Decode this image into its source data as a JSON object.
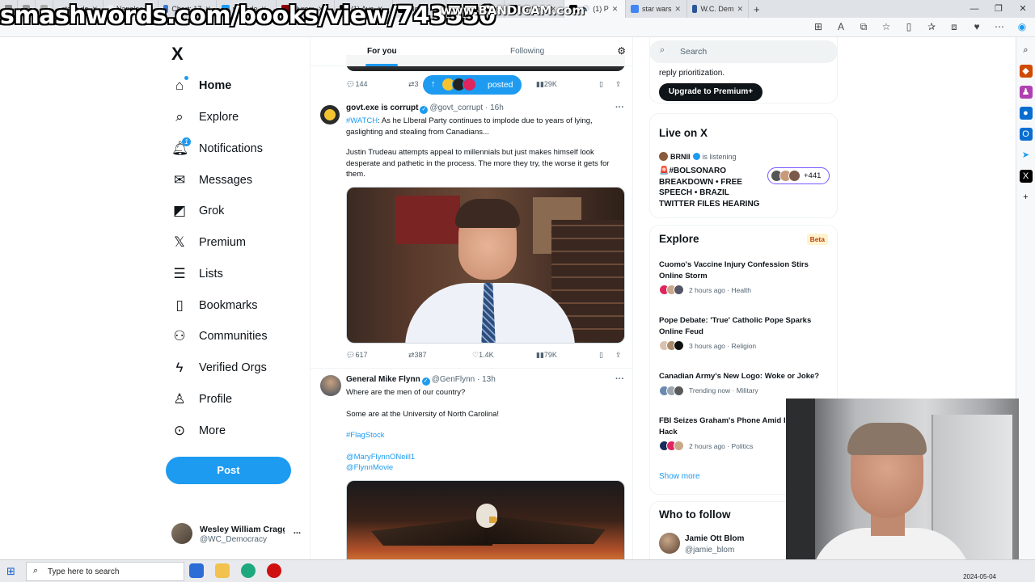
{
  "watermark": "smashwords.com/books/view/743550",
  "recorder": "www.BANDICAM.com",
  "browser": {
    "tabs": [
      {
        "label": "stalin de"
      },
      {
        "label": "Napoleo"
      },
      {
        "label": "Chart: 17"
      },
      {
        "label": "ww2 de"
      },
      {
        "label": "Nurem"
      },
      {
        "label": "(1) Ava"
      },
      {
        "label": "Home"
      },
      {
        "label": "waking u"
      },
      {
        "label": "(1) Dom"
      },
      {
        "label": "(1) P"
      },
      {
        "label": "star wars"
      },
      {
        "label": "W.C. Dem"
      }
    ],
    "new_tab": "+"
  },
  "nav": {
    "logo": "X",
    "items": [
      {
        "label": "Home",
        "icon": "home-icon"
      },
      {
        "label": "Explore",
        "icon": "search-icon"
      },
      {
        "label": "Notifications",
        "icon": "bell-icon",
        "badge": "1"
      },
      {
        "label": "Messages",
        "icon": "envelope-icon"
      },
      {
        "label": "Grok",
        "icon": "grok-icon"
      },
      {
        "label": "Premium",
        "icon": "x-icon"
      },
      {
        "label": "Lists",
        "icon": "list-icon"
      },
      {
        "label": "Bookmarks",
        "icon": "bookmark-icon"
      },
      {
        "label": "Communities",
        "icon": "people-icon"
      },
      {
        "label": "Verified Orgs",
        "icon": "lightning-icon"
      },
      {
        "label": "Profile",
        "icon": "person-icon"
      },
      {
        "label": "More",
        "icon": "more-circle-icon"
      }
    ],
    "post_button": "Post",
    "account": {
      "name": "Wesley William Cragg",
      "handle": "@WC_Democracy",
      "more": "..."
    }
  },
  "timeline": {
    "tabs": [
      "For you",
      "Following"
    ],
    "posted_pill": "posted",
    "prev_actions": {
      "replies": "144",
      "reposts": "3",
      "likes": "",
      "views": "29K"
    },
    "tweets": [
      {
        "name": "govt.exe is corrupt",
        "handle": "@govt_corrupt",
        "time": "· 16h",
        "hashtag": "#WATCH",
        "text1": ": As he LIberal Party continues to  implode due to years of lying, gaslighting and stealing from Canadians...",
        "text2": "Justin Trudeau attempts appeal to millennials but just makes himself look desperate and pathetic in the process. The more they try, the worse it gets for them.",
        "replies": "617",
        "reposts": "387",
        "likes": "1.4K",
        "views": "79K"
      },
      {
        "name": "General Mike Flynn",
        "handle": "@GenFlynn",
        "time": "· 13h",
        "line1": "Where are the men of our country?",
        "line2": "Some are at the University of North Carolina!",
        "hashtag": "#FlagStock",
        "mention1": "@MaryFlynnONeill1",
        "mention2": "@FlynnMovie"
      }
    ]
  },
  "sidebar": {
    "search_placeholder": "Search",
    "premium": {
      "text": "reply prioritization.",
      "button": "Upgrade to Premium+"
    },
    "live": {
      "title": "Live on X",
      "host": "BRNII",
      "status": "is listening",
      "space_title": "🚨#BOLSONARO BREAKDOWN • FREE SPEECH • BRAZIL TWITTER FILES HEARING",
      "listeners": "+441"
    },
    "explore": {
      "title": "Explore",
      "beta": "Beta",
      "trends": [
        {
          "title": "Cuomo's Vaccine Injury Confession Stirs Online Storm",
          "meta": "2 hours ago · Health"
        },
        {
          "title": "Pope Debate: 'True' Catholic Pope Sparks Online Feud",
          "meta": "3 hours ago · Religion"
        },
        {
          "title": "Canadian Army's New Logo: Woke or Joke?",
          "meta": "Trending now · Military"
        },
        {
          "title": "FBI Seizes Graham's Phone Amid Imposter Hack",
          "meta": "2 hours ago · Politics"
        }
      ],
      "show_more": "Show more"
    },
    "follow": {
      "title": "Who to follow",
      "name": "Jamie Ott Blom",
      "handle": "@jamie_blom"
    }
  },
  "taskbar": {
    "search_placeholder": "Type here to search",
    "date": "2024-05-04"
  },
  "colors": {
    "accent": "#1d9bf0",
    "text": "#0f1419",
    "muted": "#536471"
  }
}
